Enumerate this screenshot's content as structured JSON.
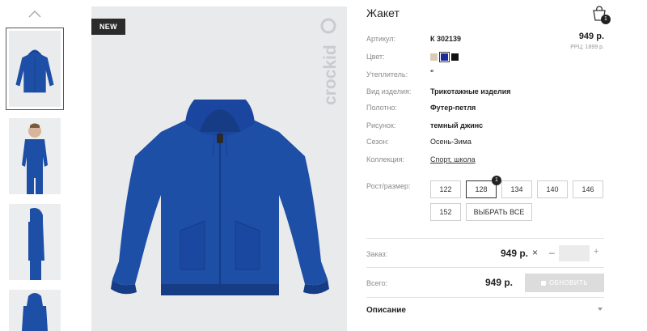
{
  "product": {
    "title": "Жакет",
    "badge": "NEW",
    "brand_logo_text": "crockid"
  },
  "cart": {
    "count": "1"
  },
  "specs": {
    "article_label": "Артикул:",
    "article_value": "К 302139",
    "color_label": "Цвет:",
    "insulation_label": "Утеплитель:",
    "insulation_value": "\"",
    "type_label": "Вид изделия:",
    "type_value": "Трикотажные изделия",
    "fabric_label": "Полотно:",
    "fabric_value": "Футер-петля",
    "pattern_label": "Рисунок:",
    "pattern_value": "темный джинс",
    "season_label": "Сезон:",
    "season_value": "Осень-Зима",
    "collection_label": "Коллекция:",
    "collection_value": "Спорт, школа"
  },
  "price": {
    "main": "949 р.",
    "rrp": "РРЦ: 1899 р."
  },
  "swatches": [
    {
      "color": "#d8ccb4",
      "selected": false
    },
    {
      "color": "#1a2a9a",
      "selected": true
    },
    {
      "color": "#111111",
      "selected": false
    }
  ],
  "sizes": {
    "label": "Рост/размер:",
    "options": [
      "122",
      "128",
      "134",
      "140",
      "146",
      "152"
    ],
    "selected": "128",
    "selected_count": "1",
    "select_all": "ВЫБРАТЬ ВСЕ"
  },
  "order": {
    "label": "Заказ:",
    "price": "949 р.",
    "times": "×",
    "minus": "–",
    "plus": "+",
    "quantity": ""
  },
  "total": {
    "label": "Всего:",
    "price": "949 р.",
    "update_button": "ОБНОВИТЬ"
  },
  "description": {
    "label": "Описание"
  },
  "colors": {
    "jacket_blue": "#1e4fa6",
    "jacket_dark": "#163c86",
    "background": "#e9eaec"
  },
  "icons": [
    "chevron-up-icon",
    "cart-icon",
    "chevron-down-icon"
  ]
}
